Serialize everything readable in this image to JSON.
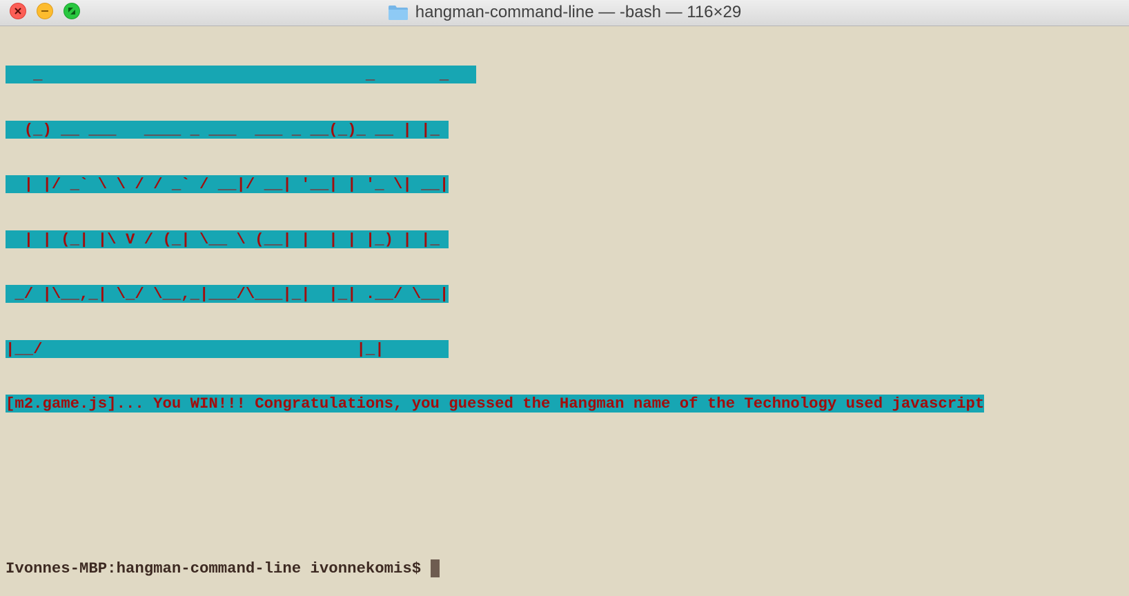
{
  "window": {
    "title": "hangman-command-line — -bash — 116×29",
    "colors": {
      "background": "#e0d9c4",
      "highlight_bg": "#17a6b3",
      "highlight_fg": "#a20d0d",
      "prompt_fg": "#3d2a22",
      "cursor": "#6e5c50"
    },
    "icons": [
      "close-icon",
      "minimize-icon",
      "fullscreen-icon",
      "folder-icon"
    ]
  },
  "terminal": {
    "banner": [
      "   _                                   _       _   ",
      "  (_) __ ___   ____ _ ___  ___ _ __(_)_ __ | |_ ",
      "  | |/ _` \\ \\ / / _` / __|/ __| '__| | '_ \\| __|",
      "  | | (_| |\\ V / (_| \\__ \\ (__| |  | | |_) | |_ ",
      " _/ |\\__,_| \\_/ \\__,_|___/\\___|_|  |_| .__/ \\__|",
      "|__/                                  |_|       "
    ],
    "win_message": "[m2.game.js]... You WIN!!! Congratulations, you guessed the Hangman name of the Technology used javascript",
    "blank_lines": [
      "",
      ""
    ],
    "prompt": "Ivonnes-MBP:hangman-command-line ivonnekomis$ "
  }
}
